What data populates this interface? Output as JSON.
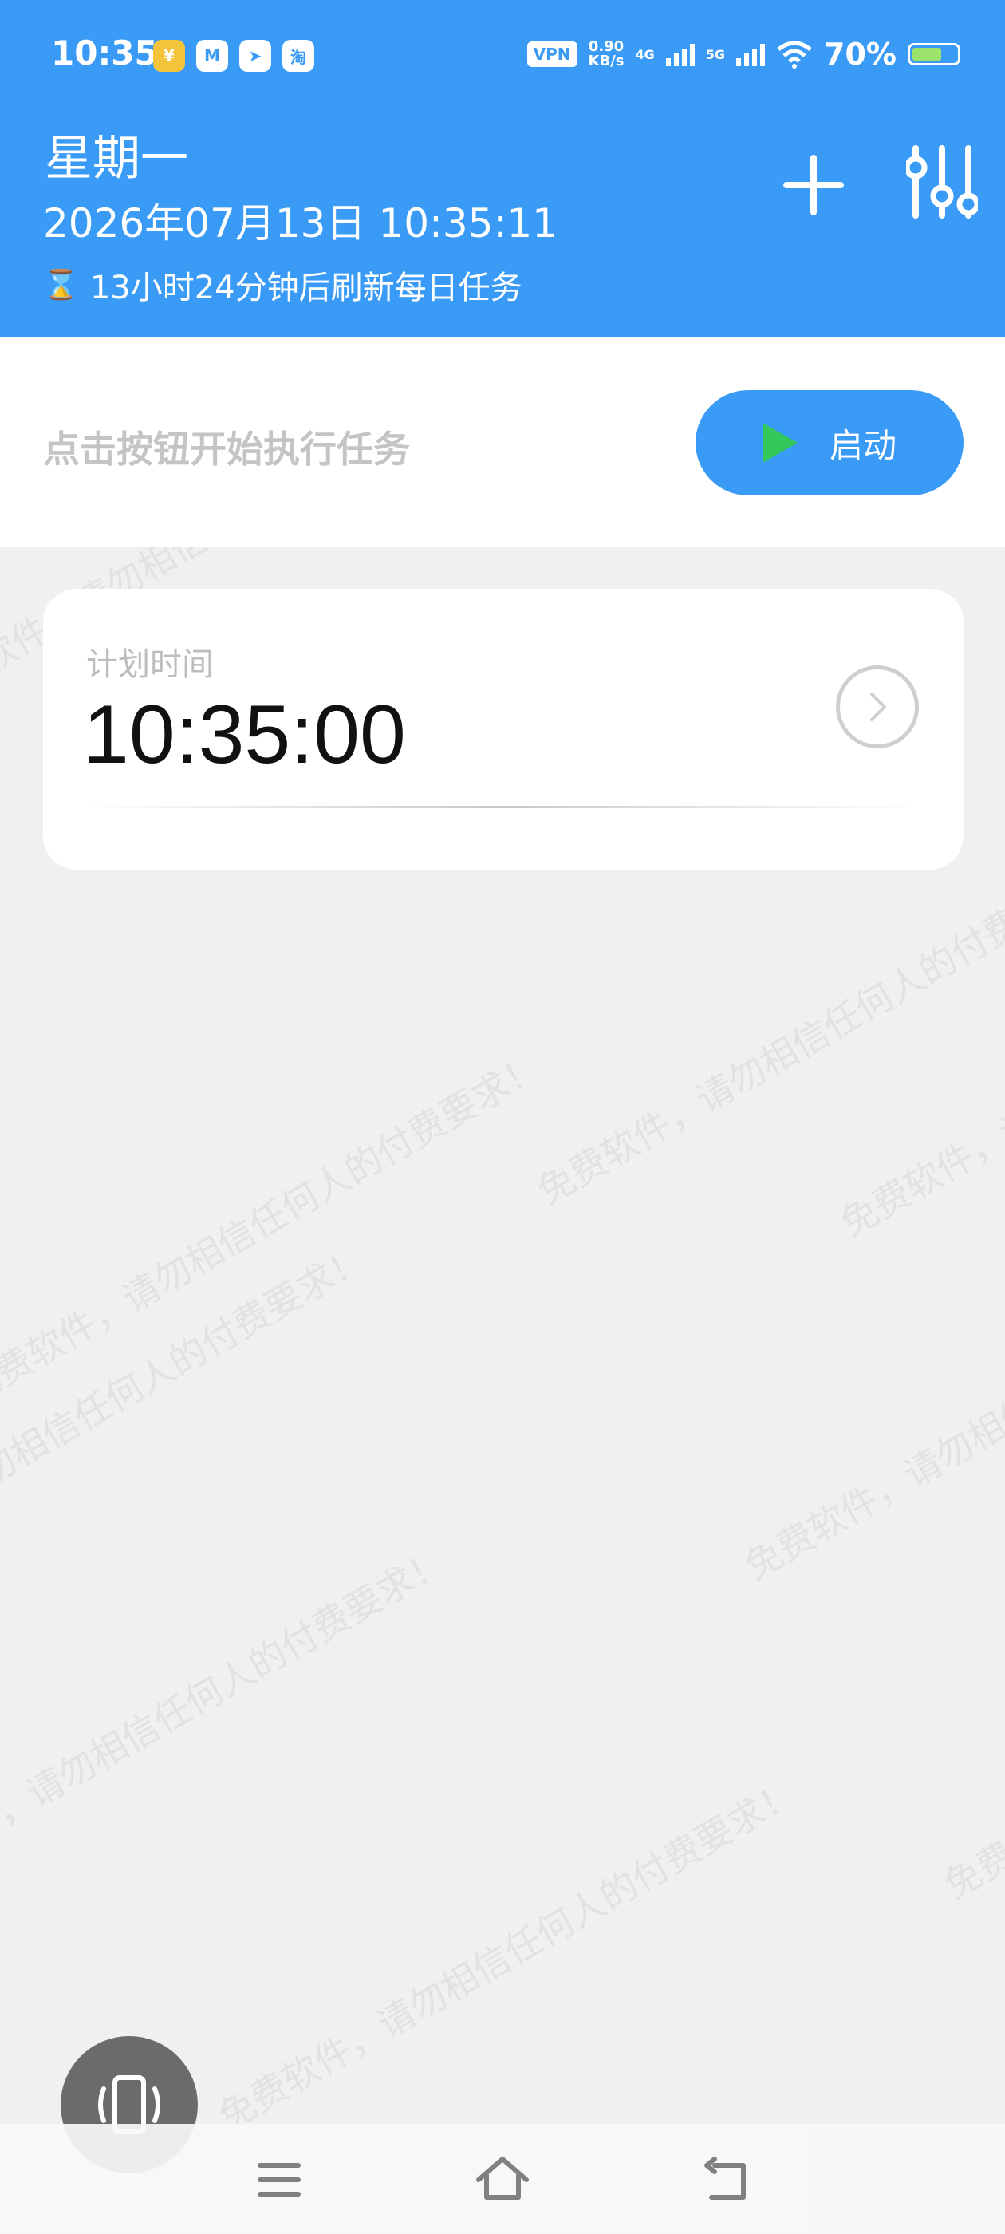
{
  "status_bar": {
    "time": "10:35",
    "app_icons": [
      {
        "name": "coin-app-icon",
        "glyph": "¥"
      },
      {
        "name": "mail-app-icon",
        "glyph": "M"
      },
      {
        "name": "telegram-app-icon",
        "glyph": "➤"
      },
      {
        "name": "taobao-app-icon",
        "glyph": "淘"
      }
    ],
    "vpn_label": "VPN",
    "speed_value": "0.90",
    "speed_unit": "KB/s",
    "network_1": "4G",
    "network_2": "5G",
    "battery_percent": "70%",
    "battery_level": 0.7
  },
  "header": {
    "weekday": "星期一",
    "datetime": "2026年07月13日 10:35:11",
    "refresh_text": "13小时24分钟后刷新每日任务",
    "hourglass_glyph": "⌛"
  },
  "action": {
    "hint": "点击按钮开始执行任务",
    "start_label": "启动"
  },
  "task_card": {
    "label": "计划时间",
    "time": "10:35:00"
  },
  "watermark": {
    "text": "免费软件，请勿相信任何人的付费要求！"
  },
  "colors": {
    "primary": "#3a9bf7",
    "play_green": "#34c759",
    "background": "#f0f0f0",
    "hint_gray": "#c4c4c4"
  }
}
